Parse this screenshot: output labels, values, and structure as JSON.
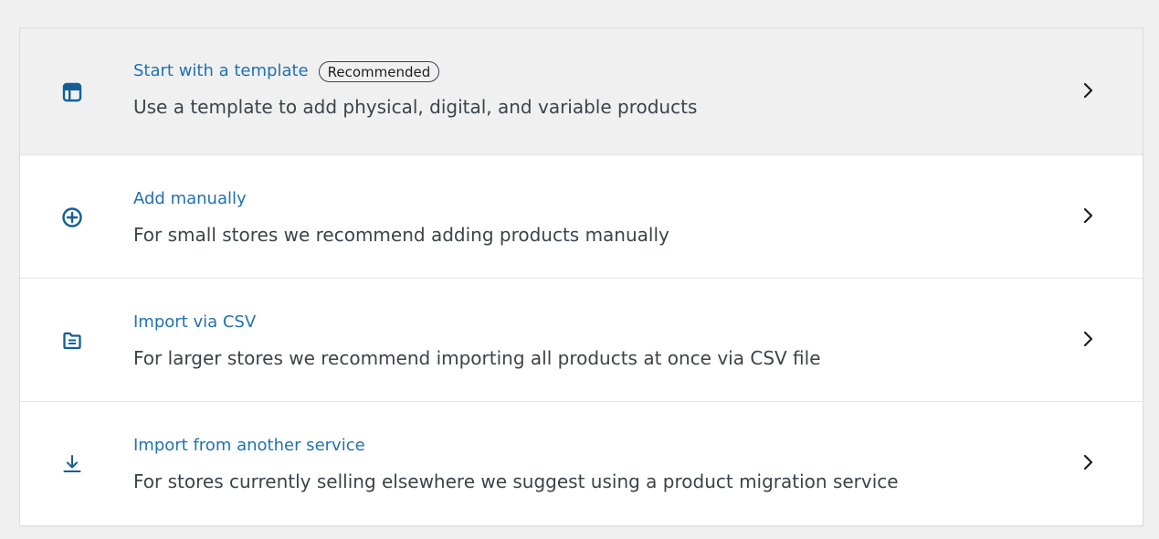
{
  "options": [
    {
      "title": "Start with a template",
      "badge": "Recommended",
      "description": "Use a template to add physical, digital, and variable products",
      "icon": "template-icon"
    },
    {
      "title": "Add manually",
      "description": "For small stores we recommend adding products manually",
      "icon": "add-circle-icon"
    },
    {
      "title": "Import via CSV",
      "description": "For larger stores we recommend importing all products at once via CSV file",
      "icon": "file-icon"
    },
    {
      "title": "Import from another service",
      "description": "For stores currently selling elsewhere we suggest using a product migration service",
      "icon": "download-icon"
    }
  ],
  "colors": {
    "title": "#2271b1",
    "icon": "#135e96",
    "description": "#3c434a",
    "highlight_row": "#f0f0f0",
    "border": "#dcdcde"
  }
}
